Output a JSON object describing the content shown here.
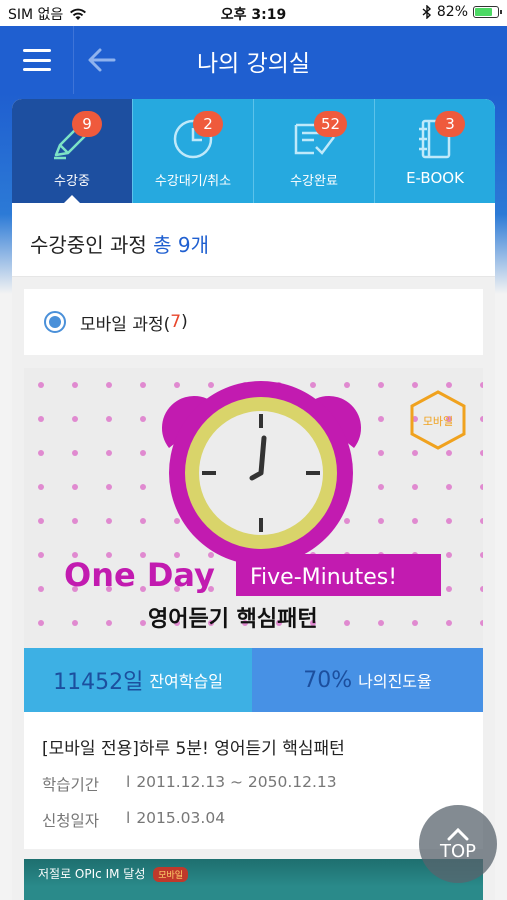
{
  "status_bar": {
    "carrier": "SIM 없음",
    "time": "오후 3:19",
    "battery_percent": "82%",
    "battery_level": 0.82
  },
  "header": {
    "title": "나의 강의실",
    "menu_icon": "hamburger-menu-icon",
    "back_icon": "arrow-left-icon"
  },
  "tabs": [
    {
      "label": "수강중",
      "badge": "9",
      "icon": "pencil-icon",
      "active": true
    },
    {
      "label": "수강대기/취소",
      "badge": "2",
      "icon": "clock-icon",
      "active": false
    },
    {
      "label": "수강완료",
      "badge": "52",
      "icon": "certificate-check-icon",
      "active": false
    },
    {
      "label": "E-BOOK",
      "badge": "3",
      "icon": "notebook-icon",
      "active": false
    }
  ],
  "summary": {
    "prefix": "수강중인 과정",
    "count_text": "총 9개"
  },
  "category": {
    "label": "모바일 과정(",
    "count": "7",
    "suffix": ")"
  },
  "course": {
    "thumbnail": {
      "badge": "모바일",
      "title_en": "One Day",
      "subtitle_en": "Five-Minutes!",
      "title_ko": "영어듣기 핵심패턴"
    },
    "remaining_days": "11452일",
    "remaining_label": "잔여학습일",
    "progress": "70%",
    "progress_label": "나의진도율",
    "title": "[모바일 전용]하루 5분! 영어듣기 핵심패턴",
    "period_label": "학습기간",
    "period_value": "2011.12.13 ~ 2050.12.13",
    "apply_label": "신청일자",
    "apply_value": "2015.03.04",
    "separator": "l"
  },
  "course2": {
    "banner_text": "저절로 OPIc IM 달성",
    "tag": "모바일"
  },
  "top_button": {
    "label": "TOP",
    "icon": "chevron-up-icon"
  },
  "colors": {
    "header_blue": "#1f5fd0",
    "tab_blue": "#26a9df",
    "tab_active": "#1d4fa0",
    "badge_red": "#ef5a3c",
    "stats_left": "#3db0e4",
    "stats_right": "#4791e5"
  }
}
